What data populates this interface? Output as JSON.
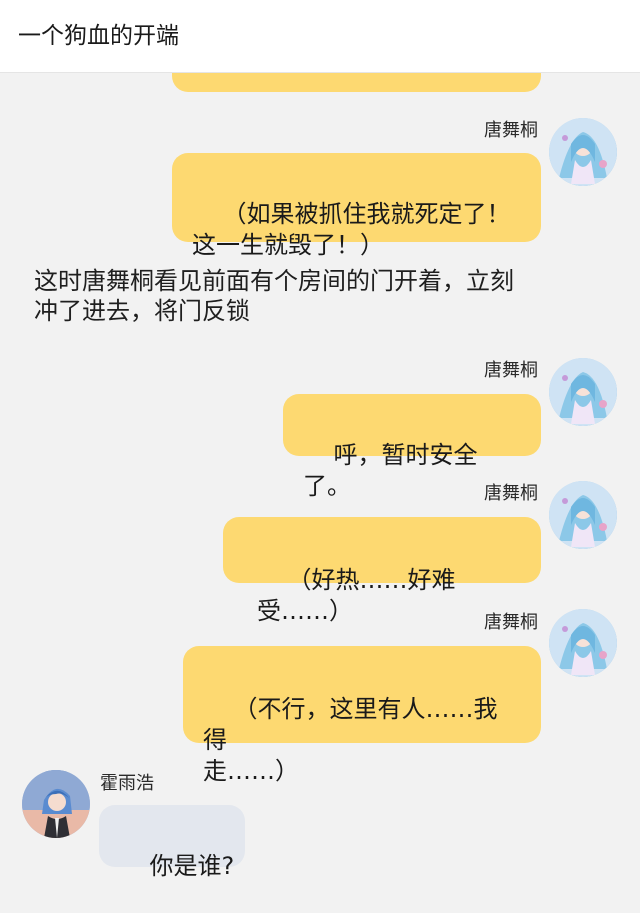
{
  "header": {
    "title": "一个狗血的开端"
  },
  "messages": [
    {
      "type": "outgoing",
      "sender": "唐舞桐",
      "text": "（如果被抓住我就死定了！\n这一生就毁了！）"
    },
    {
      "type": "narration",
      "text": "这时唐舞桐看见前面有个房间的门开着，立刻\n冲了进去，将门反锁"
    },
    {
      "type": "outgoing",
      "sender": "唐舞桐",
      "text": "呼，暂时安全了。"
    },
    {
      "type": "outgoing",
      "sender": "唐舞桐",
      "text": "（好热……好难受……）"
    },
    {
      "type": "outgoing",
      "sender": "唐舞桐",
      "text": "（不行，这里有人……我得\n走……）"
    },
    {
      "type": "incoming",
      "sender": "霍雨浩",
      "text": "你是谁?"
    }
  ],
  "colors": {
    "outgoing_bubble": "#fdd971",
    "incoming_bubble": "#e3e7ee",
    "background": "#f2f2f2"
  }
}
